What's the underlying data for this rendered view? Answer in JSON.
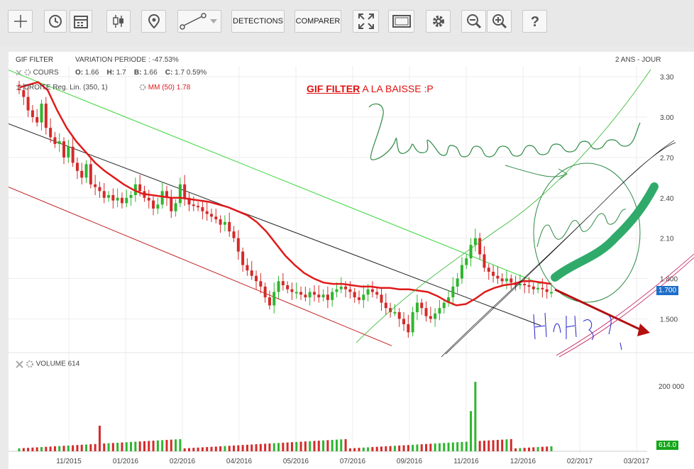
{
  "toolbar": {
    "detections_label": "DETECTIONS",
    "comparer_label": "COMPARER",
    "icons": [
      "crosshair-icon",
      "history-icon",
      "calendar-icon",
      "candlestick-icon",
      "marker-icon",
      "line-tool-icon",
      "dropdown-arrow-icon",
      "fullscreen-icon",
      "frame-icon",
      "gear-icon",
      "zoom-out-icon",
      "zoom-in-icon",
      "help-icon"
    ]
  },
  "header": {
    "title": "GIF FILTER",
    "variation": "VARIATION PERIODE : -47.53%",
    "period": "2 ANS - JOUR"
  },
  "legend": {
    "cours_label": "COURS",
    "o_label": "O:",
    "o_value": "1.66",
    "h_label": "H:",
    "h_value": "1.7",
    "b_label": "B:",
    "b_value": "1.66",
    "c_label": "C:",
    "c_value": "1.7 0.59%",
    "droite_label": "DROITE Reg. Lin. (350, 1)",
    "mm_label": "MM (50)",
    "mm_value": "1.78"
  },
  "annotation": {
    "title_underlined": "GIF FILTER",
    "title_rest": "A LA BAISSE  :P"
  },
  "price_tag": "1.700",
  "volume": {
    "label": "VOLUME",
    "value": "614",
    "axis_label": "200 000",
    "tag": "614.0"
  },
  "colors": {
    "up": "#2fb52f",
    "down": "#d42a2a",
    "ma": "#e01a1a",
    "trend": "#222222",
    "upper_channel": "#39d739",
    "lower_channel": "#c02020",
    "price_tag": "#1e6fc9",
    "volume_tag": "#16a51a",
    "highlight": "#2faa6a",
    "hand_ink": "#2e8a45",
    "hand_blue": "#2222cc"
  },
  "chart_data": {
    "type": "candlestick",
    "y_ticks": [
      3.3,
      3.0,
      2.7,
      2.4,
      2.1,
      1.8,
      1.5
    ],
    "y_tick_labels": [
      "3.30",
      "3.00",
      "2.70",
      "2.40",
      "2.10",
      "1.800",
      "1.500"
    ],
    "ylim": [
      1.27,
      3.38
    ],
    "x_tick_labels": [
      "11/2015",
      "01/2016",
      "02/2016",
      "04/2016",
      "05/2016",
      "07/2016",
      "09/2016",
      "11/2016",
      "12/2016",
      "02/2017",
      "03/2017"
    ],
    "xlim": [
      0,
      120
    ],
    "close_series": [
      3.2,
      3.15,
      3.05,
      3.0,
      2.96,
      3.1,
      2.92,
      2.85,
      2.8,
      2.82,
      2.7,
      2.78,
      2.66,
      2.6,
      2.55,
      2.65,
      2.5,
      2.48,
      2.45,
      2.4,
      2.42,
      2.38,
      2.4,
      2.36,
      2.4,
      2.42,
      2.5,
      2.45,
      2.4,
      2.38,
      2.32,
      2.35,
      2.45,
      2.4,
      2.3,
      2.36,
      2.5,
      2.4,
      2.35,
      2.34,
      2.33,
      2.3,
      2.28,
      2.26,
      2.24,
      2.2,
      2.22,
      2.15,
      2.1,
      2.0,
      1.9,
      1.86,
      1.82,
      1.78,
      1.74,
      1.66,
      1.6,
      1.7,
      1.78,
      1.75,
      1.72,
      1.7,
      1.7,
      1.68,
      1.66,
      1.7,
      1.68,
      1.66,
      1.68,
      1.64,
      1.7,
      1.72,
      1.74,
      1.72,
      1.7,
      1.66,
      1.64,
      1.68,
      1.72,
      1.7,
      1.68,
      1.62,
      1.58,
      1.55,
      1.55,
      1.5,
      1.46,
      1.4,
      1.55,
      1.62,
      1.58,
      1.52,
      1.5,
      1.54,
      1.58,
      1.62,
      1.66,
      1.74,
      1.8,
      1.9,
      1.95,
      2.05,
      2.1,
      1.98,
      1.88,
      1.85,
      1.82,
      1.8,
      1.78,
      1.8,
      1.77,
      1.75,
      1.76,
      1.75,
      1.74,
      1.72,
      1.73,
      1.72,
      1.7,
      1.7
    ],
    "ma_series": [
      3.22,
      3.24,
      3.26,
      3.2,
      3.05,
      2.92,
      2.82,
      2.74,
      2.66,
      2.6,
      2.55,
      2.5,
      2.46,
      2.43,
      2.42,
      2.41,
      2.4,
      2.4,
      2.39,
      2.38,
      2.37,
      2.35,
      2.33,
      2.3,
      2.27,
      2.22,
      2.15,
      2.06,
      1.97,
      1.9,
      1.84,
      1.8,
      1.77,
      1.76,
      1.76,
      1.75,
      1.74,
      1.74,
      1.73,
      1.73,
      1.72,
      1.72,
      1.71,
      1.7,
      1.67,
      1.63,
      1.6,
      1.61,
      1.65,
      1.7,
      1.73,
      1.75,
      1.76,
      1.78,
      1.78,
      1.77,
      1.76
    ],
    "trend_line": [
      [
        0,
        2.95
      ],
      [
        100,
        1.45
      ]
    ],
    "upper_channel": [
      [
        0,
        3.35
      ],
      [
        100,
        1.76
      ]
    ],
    "lower_channel": [
      [
        0,
        2.48
      ],
      [
        72,
        1.3
      ]
    ],
    "volume_max": 200000
  }
}
